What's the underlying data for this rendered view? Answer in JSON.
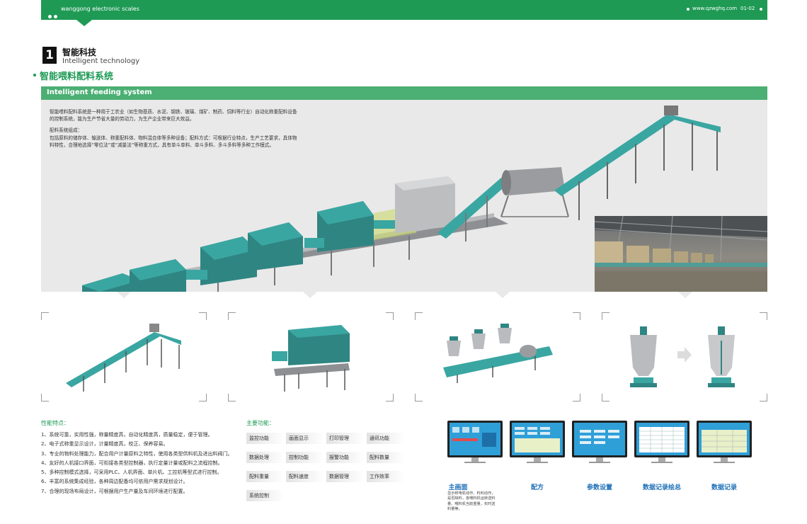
{
  "header": {
    "brand": "wanggong electronic scales",
    "url": "www.qzwghq.com",
    "page": "01-02"
  },
  "section": {
    "number": "1",
    "title_cn": "智能科技",
    "title_en": "Intelligent technology"
  },
  "heading": "智能喂料配料系统",
  "banner": "Intelligent feeding system",
  "intro": {
    "p1": "智能喂料配料系统是一种用于工农业（如生物基质、水泥、钢铁、玻璃、煤矿、制药、饲料等行业）自动化称重配料设备的控制系统，能为生产节省大量的劳动力，为生产企业带来巨大效益。",
    "p2_title": "配料系统组成：",
    "p2": "包括原料的储存体、输送体、称重配料体、物料混合体等多种设备；配料方式：可根据行业特点，生产工艺要求，具体物料特性，合理地选择“零位法”或“减量法”等称重方式，具有单斗单料、单斗多料、多斗多料等多种工作模式。"
  },
  "features": {
    "title": "性能特点：",
    "items": [
      "1、系统可靠，实用性强，称量精度高，自动化精度高，质量稳定，便于管理。",
      "2、电子式称重显示设计，计量精度高，校正、保养容易。",
      "3、专业的物料处理能力，配合用户计量原料之特性，使用各类型供料机及进出料阀门。",
      "4、友好的人机接口界面，可衔接各类型控制器，执行定量计量或配料之流程控制。",
      "5、多种控制模式选择，可采用PLC、人机界面、单片机、工控机等型式进行控制。",
      "6、丰富的系统集成经验，各种周边配备均可依用户需求规划设计。",
      "7、合理的现场布局设计，可根据用户生产量及车间环境进行配置。"
    ]
  },
  "functions": {
    "title": "主要功能：",
    "buttons": [
      "监控功能",
      "画面显示",
      "打印管理",
      "通讯功能",
      "数据处理",
      "控制功能",
      "报警功能",
      "配料数量",
      "配料重量",
      "配料速度",
      "数据管理",
      "工作效率",
      "系统控制"
    ]
  },
  "screens": {
    "labels": [
      "主画面",
      "配方",
      "参数设置",
      "数据记录绘总",
      "数据记录"
    ],
    "main_desc": "显示称电机动作、料料动作，是否缺料，各喂料机运转送料量、喂料机当前重量，实时送料量等。"
  },
  "colors": {
    "brand_green": "#1e9a55",
    "banner_green": "#4caf74",
    "machine_teal": "#3aa6a2",
    "screen_blue": "#2f9fd8",
    "label_blue": "#1e6fb8"
  }
}
